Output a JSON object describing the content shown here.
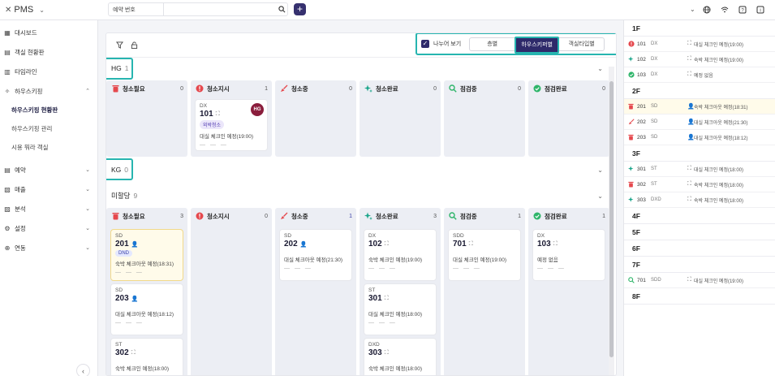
{
  "app": {
    "name": "PMS"
  },
  "search": {
    "select_label": "예약 번호",
    "placeholder": ""
  },
  "sidebar": {
    "items": [
      {
        "label": "대시보드",
        "icon": "grid-icon",
        "chev": ""
      },
      {
        "label": "객실 현황판",
        "icon": "calendar-icon",
        "chev": ""
      },
      {
        "label": "타임라인",
        "icon": "timeline-icon",
        "chev": ""
      },
      {
        "label": "하우스키핑",
        "icon": "sparkle-icon",
        "chev": "⌃"
      }
    ],
    "subitems": [
      "하우스키핑 현황판",
      "하우스키핑 관리",
      "시용 뭐라 객실"
    ],
    "items2": [
      {
        "label": "예약",
        "icon": "calendar-icon"
      },
      {
        "label": "매출",
        "icon": "receipt-icon"
      },
      {
        "label": "분석",
        "icon": "chart-icon"
      },
      {
        "label": "설정",
        "icon": "gear-icon"
      },
      {
        "label": "연동",
        "icon": "link-icon"
      }
    ]
  },
  "toolbar": {
    "split_label": "나누어 보기",
    "segments": [
      {
        "label": "층별",
        "active": false
      },
      {
        "label": "하우스키퍼별",
        "active": true
      },
      {
        "label": "객실타입별",
        "active": false
      }
    ]
  },
  "groups": [
    {
      "name": "HG",
      "count": "1"
    },
    {
      "name": "KG",
      "count": "0"
    },
    {
      "name": "미할당",
      "count": "9"
    }
  ],
  "columns": [
    {
      "label": "청소필요",
      "icon": "trash"
    },
    {
      "label": "청소지시",
      "icon": "alert"
    },
    {
      "label": "청소중",
      "icon": "broom"
    },
    {
      "label": "청소완료",
      "icon": "sparkle"
    },
    {
      "label": "점검중",
      "icon": "search"
    },
    {
      "label": "점검완료",
      "icon": "check"
    }
  ],
  "hg_counts": [
    "0",
    "1",
    "0",
    "0",
    "0",
    "0"
  ],
  "un_counts": [
    "3",
    "0",
    "1",
    "3",
    "1",
    "1"
  ],
  "hg_card": {
    "type": "DX",
    "room": "101",
    "mini": "⛶",
    "badge": "외박청소",
    "note": "대실 체크인 예정(19:00)",
    "dash": "— — —",
    "avatar": "HG"
  },
  "cards": {
    "c0a": {
      "type": "SD",
      "room": "201",
      "mini": "👤",
      "badge": "DND",
      "note": "숙박 체크아웃 예정(18:31)",
      "dash": "— — —"
    },
    "c0b": {
      "type": "SD",
      "room": "203",
      "mini": "👤",
      "note": "대실 체크아웃 예정(18:12)",
      "dash": "— — —"
    },
    "c0c": {
      "type": "ST",
      "room": "302",
      "mini": "⛶",
      "note": "숙박 체크인 예정(18:00)"
    },
    "c2a": {
      "type": "SD",
      "room": "202",
      "mini": "👤",
      "note": "대실 체크아웃 예정(21:30)",
      "dash": "— — —"
    },
    "c3a": {
      "type": "DX",
      "room": "102",
      "mini": "⛶",
      "note": "숙박 체크인 예정(19:00)",
      "dash": "— — —"
    },
    "c3b": {
      "type": "ST",
      "room": "301",
      "mini": "⛶",
      "note": "대실 체크인 예정(18:00)",
      "dash": "— — —"
    },
    "c3c": {
      "type": "DXD",
      "room": "303",
      "mini": "⛶",
      "note": "숙박 체크인 예정(18:00)"
    },
    "c4a": {
      "type": "SDD",
      "room": "701",
      "mini": "⛶",
      "note": "대실 체크인 예정(19:00)",
      "dash": "— — —"
    },
    "c5a": {
      "type": "DX",
      "room": "103",
      "mini": "⛶",
      "note": "예정 없음",
      "dash": "— — —"
    }
  },
  "floors": [
    {
      "floor": "1F",
      "rows": [
        {
          "icon": "alert",
          "room": "101",
          "type": "DX",
          "person": "⛶",
          "note": "대실 체크인 예정(19:00)",
          "hi": false
        },
        {
          "icon": "sparkle",
          "room": "102",
          "type": "DX",
          "person": "⛶",
          "note": "숙박 체크인 예정(19:00)",
          "hi": false
        },
        {
          "icon": "check",
          "room": "103",
          "type": "DX",
          "person": "⛶",
          "note": "예정 없음",
          "hi": false
        }
      ]
    },
    {
      "floor": "2F",
      "rows": [
        {
          "icon": "trash",
          "room": "201",
          "type": "SD",
          "person": "👤",
          "note": "숙박 체크아웃 예정(18:31)",
          "hi": true
        },
        {
          "icon": "broom",
          "room": "202",
          "type": "SD",
          "person": "👤",
          "note": "대실 체크아웃 예정(21:30)",
          "hi": false
        },
        {
          "icon": "trash",
          "room": "203",
          "type": "SD",
          "person": "👤",
          "note": "대실 체크아웃 예정(18:12)",
          "hi": false
        }
      ]
    },
    {
      "floor": "3F",
      "rows": [
        {
          "icon": "sparkle",
          "room": "301",
          "type": "ST",
          "person": "⛶",
          "note": "대실 체크인 예정(18:00)",
          "hi": false
        },
        {
          "icon": "trash",
          "room": "302",
          "type": "ST",
          "person": "⛶",
          "note": "숙박 체크인 예정(18:00)",
          "hi": false
        },
        {
          "icon": "sparkle",
          "room": "303",
          "type": "DXD",
          "person": "⛶",
          "note": "숙박 체크인 예정(18:00)",
          "hi": false
        }
      ]
    },
    {
      "floor": "4F",
      "rows": []
    },
    {
      "floor": "5F",
      "rows": []
    },
    {
      "floor": "6F",
      "rows": []
    },
    {
      "floor": "7F",
      "rows": [
        {
          "icon": "search",
          "room": "701",
          "type": "SDD",
          "person": "⛶",
          "note": "대실 체크인 예정(19:00)",
          "hi": false
        }
      ]
    },
    {
      "floor": "8F",
      "rows": []
    }
  ],
  "colors": {
    "accent": "#2e2a6a",
    "highlight": "#27b5b0",
    "red": "#e5484d",
    "green": "#2fb56a",
    "teal": "#1aa58a",
    "dnd_bg": "#fffbea"
  }
}
